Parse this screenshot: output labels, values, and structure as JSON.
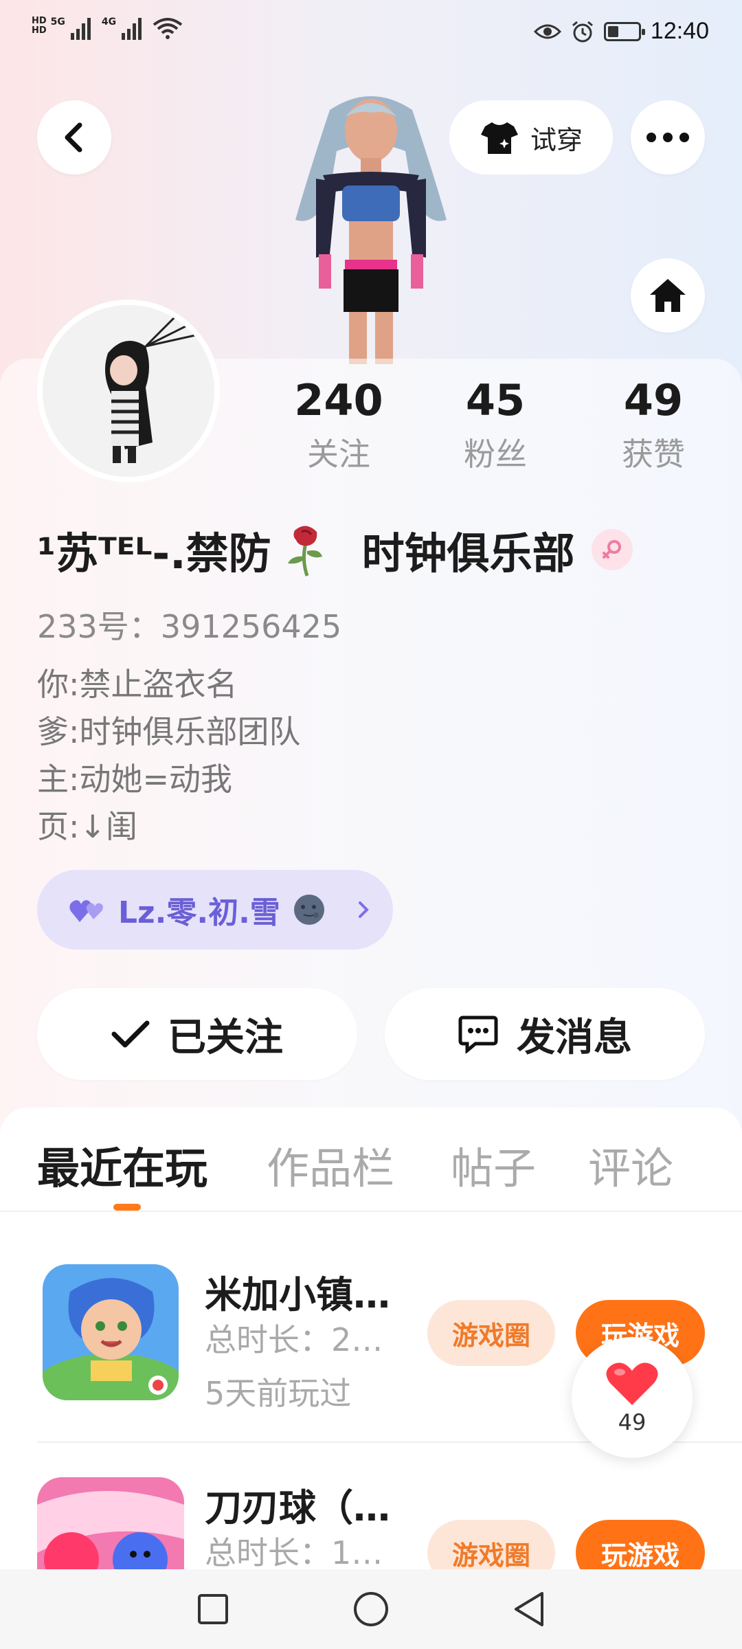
{
  "status_bar": {
    "hd_top": "HD",
    "hd_bottom": "HD",
    "net1": "5G",
    "net2": "4G",
    "time": "12:40",
    "battery_level": 0.34
  },
  "header": {
    "tryon_label": "试穿"
  },
  "profile": {
    "stats": [
      {
        "value": "240",
        "label": "关注"
      },
      {
        "value": "45",
        "label": "粉丝"
      },
      {
        "value": "49",
        "label": "获赞"
      }
    ],
    "nickname_prefix": "¹苏ᵀᴱᴸ-.禁防",
    "nickname_suffix": "时钟俱乐部",
    "uid": "233号：391256425",
    "bio": [
      "你:禁止盗衣名",
      "爹:时钟俱乐部团队",
      "主:动她=动我",
      "页:↓闺"
    ],
    "link_chip": "Lz.零.初.雪"
  },
  "actions": {
    "follow_label": "已关注",
    "message_label": "发消息"
  },
  "tabs": [
    "最近在玩",
    "作品栏",
    "帖子",
    "评论"
  ],
  "games": [
    {
      "title": "米加小镇…",
      "duration": "总时长：2…",
      "last_played": "5天前玩过",
      "circle_label": "游戏圈",
      "play_label": "玩游戏"
    },
    {
      "title": "刀刃球（…",
      "duration": "总时长：1…",
      "circle_label": "游戏圈",
      "play_label": "玩游戏"
    }
  ],
  "like_float": {
    "count": "49"
  },
  "colors": {
    "accent": "#ff7316",
    "chip_text": "#6a5fd6",
    "chip_bg": "#e6e2fa",
    "like_red": "#ff3b4a"
  }
}
